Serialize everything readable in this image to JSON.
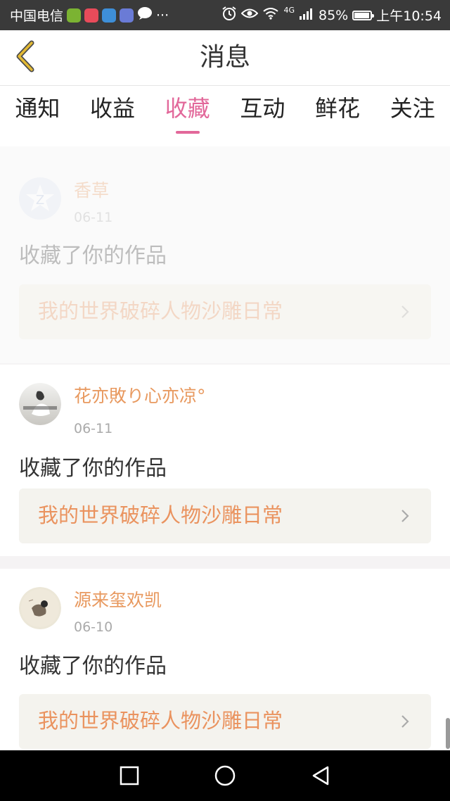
{
  "status_bar": {
    "carrier": "中国电信",
    "more": "···",
    "network": "4G",
    "battery": "85%",
    "battery_level": 0.85,
    "time": "上午10:54",
    "app_icon_colors": [
      "#7bb332",
      "#e84b5a",
      "#3e8fd8",
      "#6a7bd6"
    ]
  },
  "header": {
    "title": "消息",
    "back_icon": "chevron-left-icon",
    "accent_color": "#e2b934"
  },
  "tabs": [
    {
      "label": "通知",
      "active": false
    },
    {
      "label": "收益",
      "active": false
    },
    {
      "label": "收藏",
      "active": true
    },
    {
      "label": "互动",
      "active": false
    },
    {
      "label": "鲜花",
      "active": false
    },
    {
      "label": "关注",
      "active": false
    }
  ],
  "colors": {
    "active_tab": "#e2689a",
    "username": "#e8995f",
    "work_title": "#ea935f",
    "feed_bg": "#f5f3f4"
  },
  "feed": [
    {
      "username": "香草",
      "date": "06-11",
      "action": "收藏了你的作品",
      "work_title": "我的世界破碎人物沙雕日常",
      "faded": true
    },
    {
      "username": "花亦敗り心亦凉°",
      "date": "06-11",
      "action": "收藏了你的作品",
      "work_title": "我的世界破碎人物沙雕日常",
      "faded": false
    },
    {
      "username": "源来玺欢凯",
      "date": "06-10",
      "action": "收藏了你的作品",
      "work_title": "我的世界破碎人物沙雕日常",
      "faded": false
    }
  ],
  "nav": {
    "recent": "square-icon",
    "home": "circle-icon",
    "back": "triangle-back-icon"
  }
}
